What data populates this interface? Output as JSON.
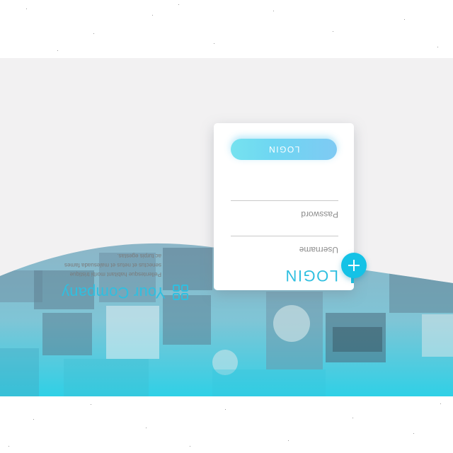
{
  "brand": {
    "name": "Your Company",
    "tagline_lines": [
      "Pellentesque habitant morbi tristique",
      "senectus et netus et malesuada fames",
      "ac turpis egestas."
    ],
    "icon": "grid-icon"
  },
  "login_card": {
    "title": "LOGIN",
    "username_label": "Username",
    "password_label": "Password",
    "button_label": "LOGIN"
  },
  "fab": {
    "icon": "plus-icon"
  },
  "colors": {
    "accent": "#1fc0e0",
    "button_start": "#7fcaf3",
    "button_end": "#76e2ef",
    "stage_bg": "#f2f1f2"
  }
}
